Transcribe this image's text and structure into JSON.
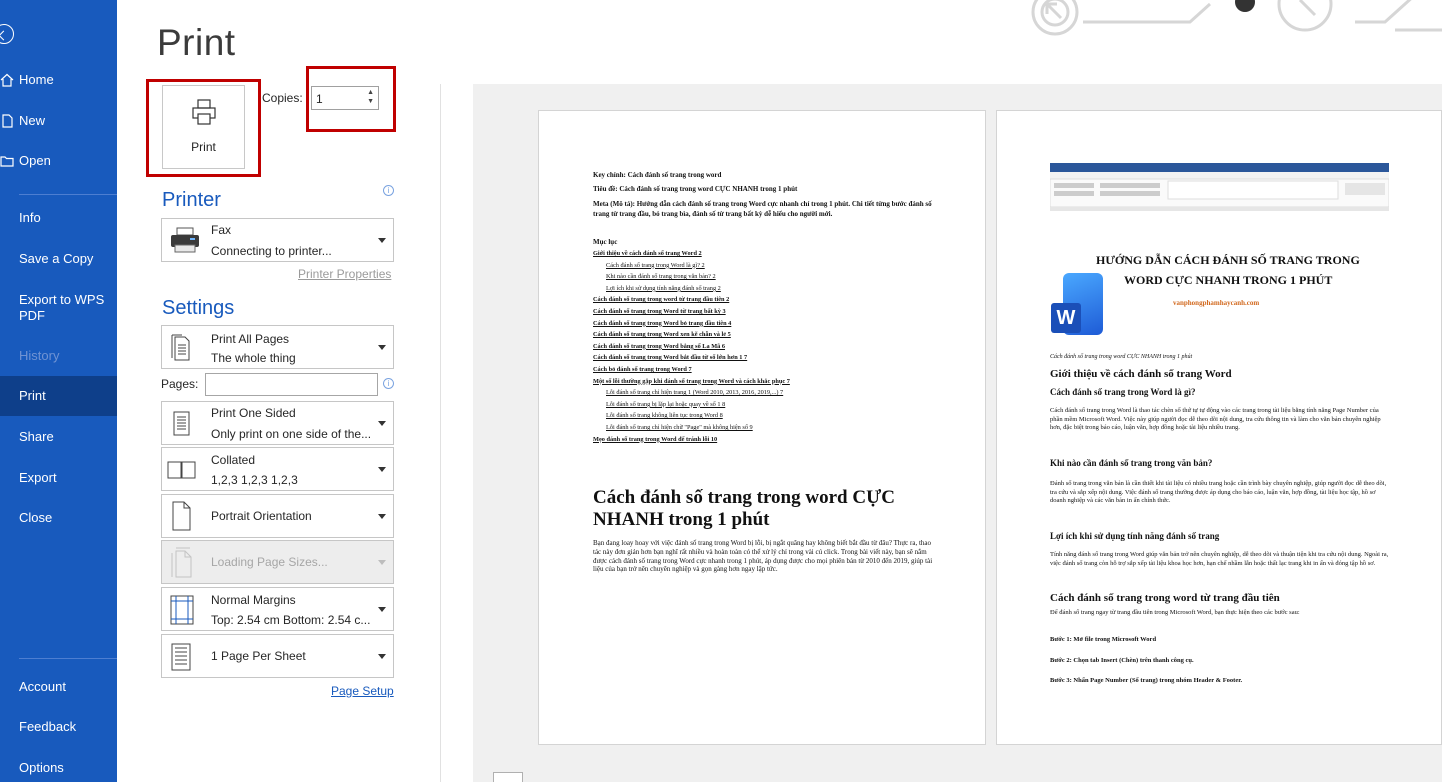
{
  "nav": {
    "home": "Home",
    "new": "New",
    "open": "Open",
    "info": "Info",
    "save_copy": "Save a Copy",
    "export_wps": "Export to WPS PDF",
    "history": "History",
    "print": "Print",
    "share": "Share",
    "export": "Export",
    "close": "Close",
    "account": "Account",
    "feedback": "Feedback",
    "options": "Options"
  },
  "title": "Print",
  "print_button": "Print",
  "copies": {
    "label": "Copies:",
    "value": "1"
  },
  "printer": {
    "heading": "Printer",
    "name": "Fax",
    "status": "Connecting to printer...",
    "properties_link": "Printer Properties"
  },
  "settings": {
    "heading": "Settings",
    "range": {
      "title": "Print All Pages",
      "sub": "The whole thing"
    },
    "pages_label": "Pages:",
    "sides": {
      "title": "Print One Sided",
      "sub": "Only print on one side of the..."
    },
    "collation": {
      "title": "Collated",
      "sub": "1,2,3   1,2,3   1,2,3"
    },
    "orientation": {
      "title": "Portrait Orientation"
    },
    "size": {
      "title": "Loading Page Sizes..."
    },
    "margins": {
      "title": "Normal Margins",
      "sub": "Top: 2.54 cm Bottom: 2.54 c..."
    },
    "per_sheet": {
      "title": "1 Page Per Sheet"
    },
    "page_setup_link": "Page Setup"
  },
  "page1": {
    "key": "Key chính: Cách đánh số trang trong word",
    "tieude": "Tiêu đề: Cách đánh số trang trong word CỰC NHANH trong 1 phút",
    "meta": "Meta (Mô tả): Hướng dẫn cách đánh số trang trong Word cực nhanh chỉ trong 1 phút. Chi tiết từng bước đánh số trang từ trang đầu, bỏ trang bìa, đánh số từ trang bất kỳ dễ hiểu cho người mới.",
    "mucluc": "Mục lục",
    "toc": [
      {
        "text": "Giới thiệu về cách đánh số trang Word",
        "page": "2",
        "level": 0
      },
      {
        "text": "Cách đánh số trang trong Word là gì?",
        "page": "2",
        "level": 1
      },
      {
        "text": "Khi nào cần đánh số trang trong văn bản?",
        "page": "2",
        "level": 1
      },
      {
        "text": "Lợi ích khi sử dụng tính năng đánh số trang",
        "page": "2",
        "level": 1
      },
      {
        "text": "Cách đánh số trang trong word từ trang đầu tiên",
        "page": "2",
        "level": 0
      },
      {
        "text": "Cách đánh số trang trong Word từ trang bất kỳ",
        "page": "3",
        "level": 0
      },
      {
        "text": "Cách đánh số trang trong Word bỏ trang đầu tiên",
        "page": "4",
        "level": 0
      },
      {
        "text": "Cách đánh số trang trong Word xen kẽ chẵn và lẻ",
        "page": "5",
        "level": 0
      },
      {
        "text": "Cách đánh số trang trong Word bằng số La Mã",
        "page": "6",
        "level": 0
      },
      {
        "text": "Cách đánh số trang trong Word bắt đầu từ số lớn hơn 1",
        "page": "7",
        "level": 0
      },
      {
        "text": "Cách bỏ đánh số trang trong Word",
        "page": "7",
        "level": 0
      },
      {
        "text": "Một số lỗi thường gặp khi đánh số trang trong Word và cách khắc phục",
        "page": "7",
        "level": 0
      },
      {
        "text": "Lỗi đánh số trang chỉ hiện trang 1 (Word 2010, 2013, 2016, 2019,...)",
        "page": "7",
        "level": 1
      },
      {
        "text": "Lỗi đánh số trang bị lặp lại hoặc quay về số 1",
        "page": "8",
        "level": 1
      },
      {
        "text": "Lỗi đánh số trang không liên tục trong Word",
        "page": "8",
        "level": 1
      },
      {
        "text": "Lỗi đánh số trang chỉ hiện chữ \"Page\" mà không hiện số",
        "page": "9",
        "level": 1
      },
      {
        "text": "Mẹo đánh số trang trong Word để tránh lỗi",
        "page": "10",
        "level": 0
      }
    ],
    "big_title": "Cách đánh số trang trong word CỰC NHANH trong 1 phút",
    "intro": "Bạn đang loay hoay với việc đánh số trang trong Word bị lỗi, bị ngắt quãng hay không biết bắt đầu từ đâu? Thực ra, thao tác này đơn giản hơn bạn nghĩ rất nhiều và hoàn toàn có thể xử lý chỉ trong vài cú click. Trong bài viết này, bạn sẽ nắm được cách đánh số trang trong Word cực nhanh trong 1 phút, áp dụng được cho mọi phiên bản từ 2010 đến 2019, giúp tài liệu của bạn trở nên chuyên nghiệp và gọn gàng hơn ngay lập tức."
  },
  "page2": {
    "banner_l1": "HƯỚNG DẪN CÁCH ĐÁNH SỐ TRANG TRONG",
    "banner_l2": "WORD CỰC NHANH TRONG 1 PHÚT",
    "banner_url": "vanphongphamhaycanh.com",
    "word_letter": "W",
    "caption": "Cách đánh số trang trong word CỰC NHANH trong 1 phút",
    "h1": "Giới thiệu về cách đánh số trang Word",
    "h2a": "Cách đánh số trang trong Word là gì?",
    "p1": "Cách đánh số trang trong Word là thao tác chèn số thứ tự tự động vào các trang trong tài liệu bằng tính năng Page Number của phần mềm Microsoft Word. Việc này giúp người đọc dễ theo dõi nội dung, tra cứu thông tin và làm cho văn bản chuyên nghiệp hơn, đặc biệt trong báo cáo, luận văn, hợp đồng hoặc tài liệu nhiều trang.",
    "h2b": "Khi nào cần đánh số trang trong văn bản?",
    "p2": "Đánh số trang trong văn bản là cần thiết khi tài liệu có nhiều trang hoặc cần trình bày chuyên nghiệp, giúp người đọc dễ theo dõi, tra cứu và sắp xếp nội dung. Việc đánh số trang thường được áp dụng cho báo cáo, luận văn, hợp đồng, tài liệu học tập, hồ sơ doanh nghiệp và các văn bản in ấn chính thức.",
    "h2c": "Lợi ích khi sử dụng tính năng đánh số trang",
    "p3": "Tính năng đánh số trang trong Word giúp văn bản trở nên chuyên nghiệp, dễ theo dõi và thuận tiện khi tra cứu nội dung. Ngoài ra, việc đánh số trang còn hỗ trợ sắp xếp tài liệu khoa học hơn, hạn chế nhầm lẫn hoặc thất lạc trang khi in ấn và đóng tập hồ sơ.",
    "h1b": "Cách đánh số trang trong word từ trang đầu tiên",
    "p4": "Để đánh số trang ngay từ trang đầu tiên trong Microsoft Word, bạn thực hiện theo các bước sau:",
    "s1": "Bước 1: Mở file trong Microsoft Word",
    "s2": "Bước 2: Chọn tab Insert (Chèn) trên thanh công cụ.",
    "s3": "Bước 3: Nhấn Page Number (Số trang) trong nhóm Header & Footer."
  }
}
